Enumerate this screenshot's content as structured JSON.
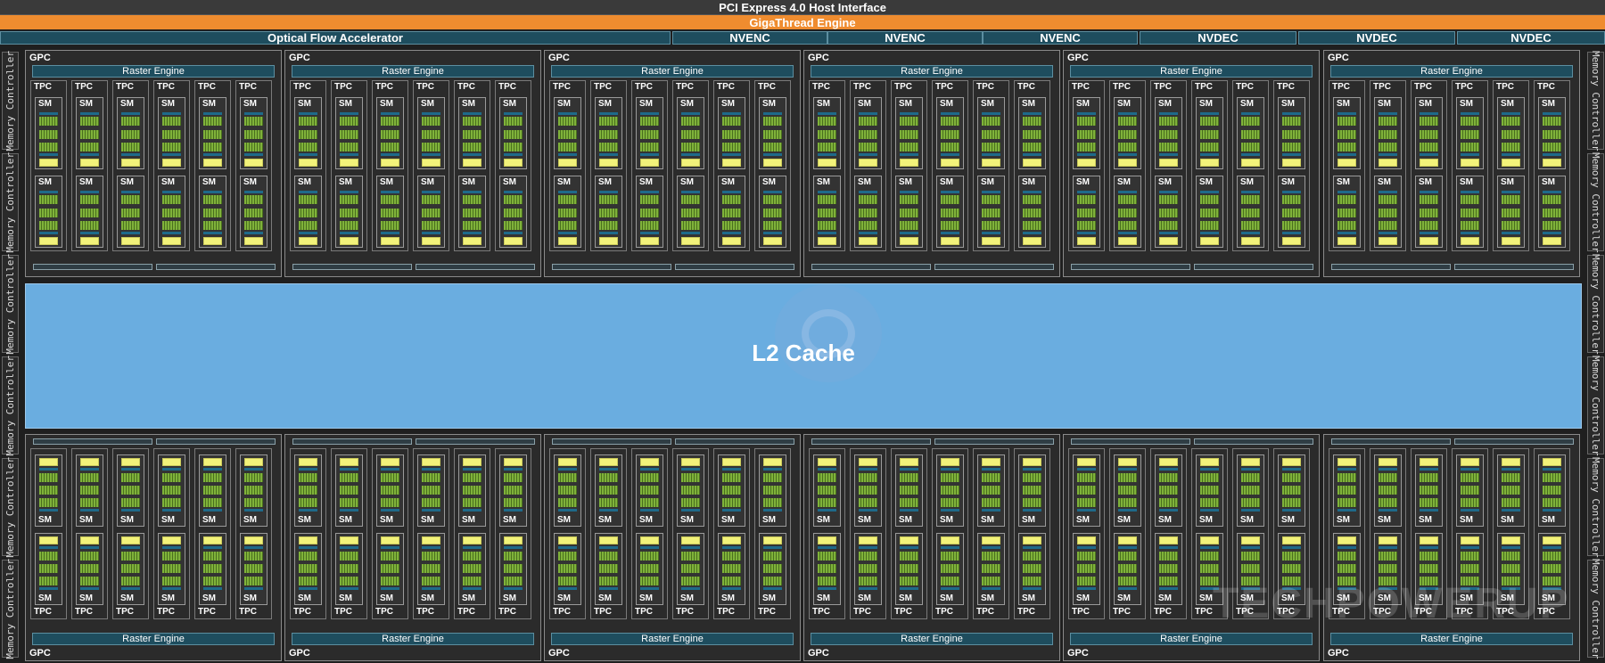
{
  "host_interface": "PCI Express 4.0 Host Interface",
  "gigathread": "GigaThread Engine",
  "top_blocks": [
    "Optical Flow Accelerator",
    "NVENC",
    "NVENC",
    "NVENC",
    "NVDEC",
    "NVDEC",
    "NVDEC"
  ],
  "l2_cache": "L2 Cache",
  "memory_controller_label": "Memory Controller",
  "gpc_label": "GPC",
  "raster_label": "Raster Engine",
  "tpc_label": "TPC",
  "sm_label": "SM",
  "watermark": "TECHPOWERUP",
  "colors": {
    "gigathread": "#ef8c2f",
    "l2_cache": "#6aade0",
    "cuda_core": "#7fb23a",
    "texture_unit": "#f2f27a",
    "engine": "#1e4d5e"
  }
}
